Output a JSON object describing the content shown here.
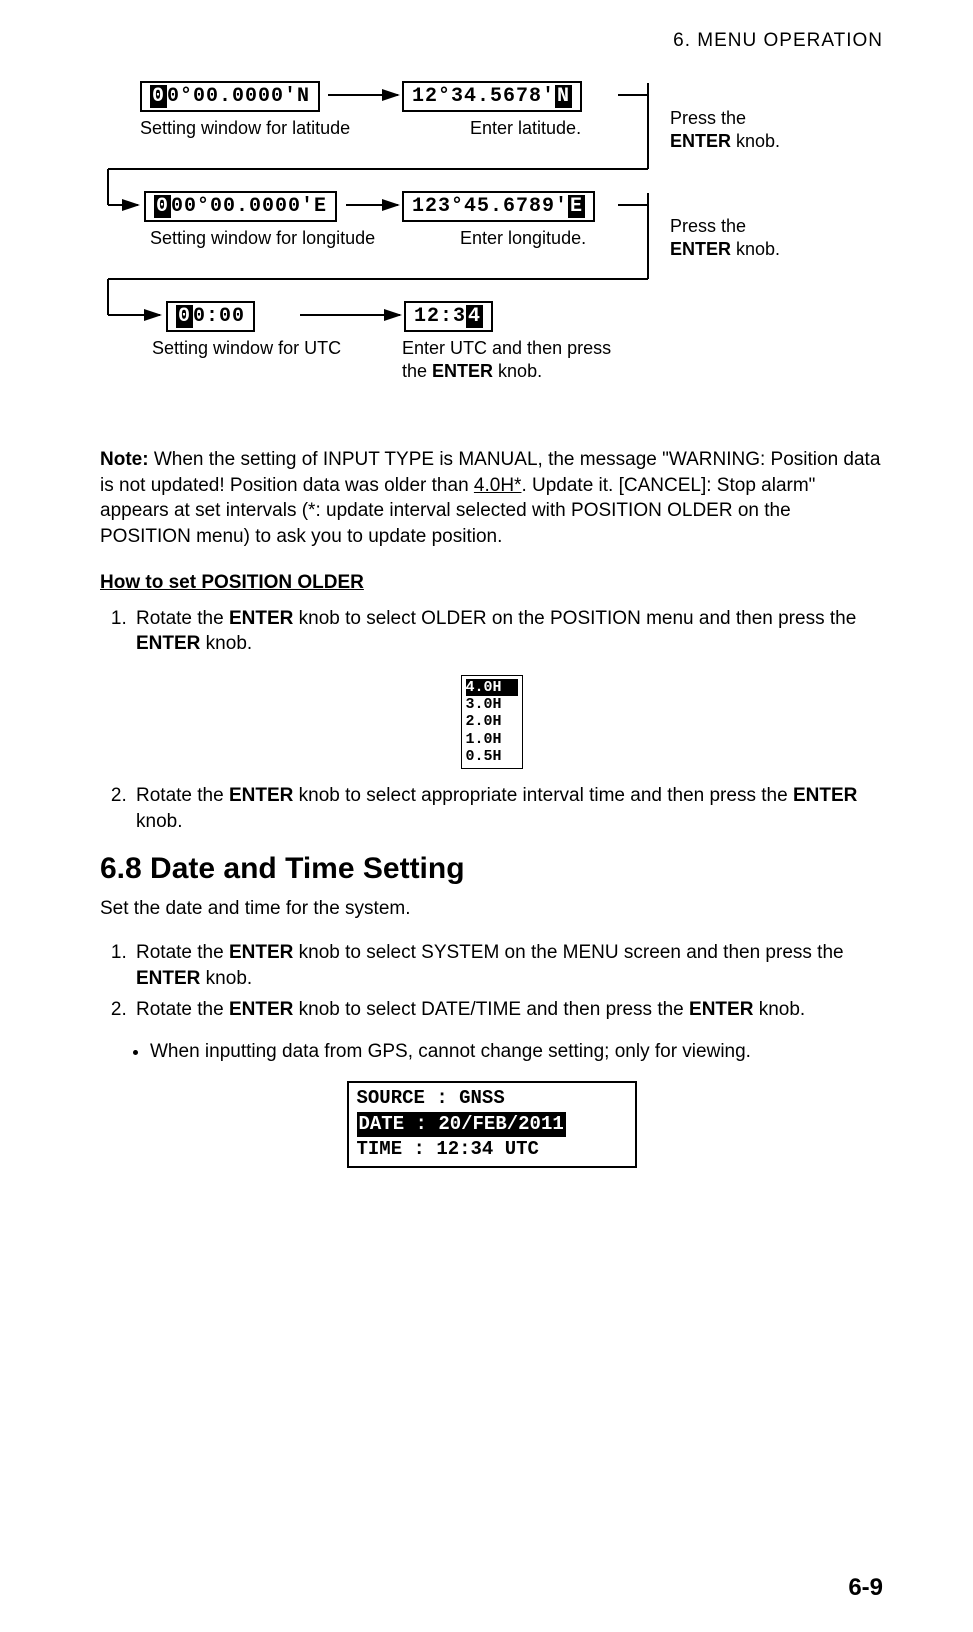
{
  "header": {
    "chapter": "6.  MENU  OPERATION"
  },
  "diagram": {
    "lat_left": {
      "pre": "0",
      "post": "0°00.0000'N"
    },
    "lat_right": {
      "pre": "12°34.5678'",
      "post": "N"
    },
    "lat_left_caption": "Setting window for latitude",
    "lat_right_caption": "Enter latitude.",
    "lon_left": {
      "pre": "0",
      "post": "00°00.0000'E"
    },
    "lon_right": {
      "pre": "123°45.6789'",
      "post": "E"
    },
    "lon_left_caption": "Setting window for longitude",
    "lon_right_caption": "Enter longitude.",
    "utc_left": {
      "pre": "0",
      "post": "0:00"
    },
    "utc_right": {
      "pre": "12:3",
      "post": "4"
    },
    "utc_left_caption": "Setting window for UTC",
    "utc_right_caption_a": "Enter UTC and then press",
    "utc_right_caption_b": "the ",
    "utc_right_caption_c": " knob.",
    "press_a": "Press the",
    "press_b": "ENTER",
    "press_c": " knob."
  },
  "note": {
    "label": "Note:",
    "t1": " When the setting of INPUT TYPE is MANUAL, the message \"WARNING: Position data is not updated! Position data was older than ",
    "u": "4.0H*",
    "t2": ". Update it. [CANCEL]: Stop alarm\" appears at set intervals (*: update interval selected with POSITION OLDER on the POSITION menu) to ask you to update position."
  },
  "older": {
    "heading": "How to set POSITION OLDER",
    "step1_a": "Rotate the ",
    "step1_b": " knob to select OLDER on the POSITION menu and then press the ",
    "step1_c": " knob.",
    "list": [
      "4.0H",
      "3.0H",
      "2.0H",
      "1.0H",
      "0.5H"
    ],
    "step2_a": "Rotate the ",
    "step2_b": " knob to select appropriate interval time and then press the ",
    "step2_c": " knob."
  },
  "sec68": {
    "title": "6.8     Date and Time Setting",
    "intro": "Set the date and time for the system.",
    "s1_a": "Rotate the ",
    "s1_b": " knob to select SYSTEM on the MENU screen and then press the ",
    "s1_c": " knob.",
    "s2_a": "Rotate the ",
    "s2_b": " knob to select DATE/TIME and then press the ",
    "s2_c": " knob.",
    "bullet": "When inputting data from GPS, cannot change setting; only for viewing.",
    "box": {
      "l1": "SOURCE : GNSS",
      "l2a": " DATE : ",
      "l2b": "20/FEB/2011",
      "l3": " TIME : 12:34 UTC"
    }
  },
  "kw": {
    "enter": "ENTER"
  },
  "page_num": "6-9"
}
